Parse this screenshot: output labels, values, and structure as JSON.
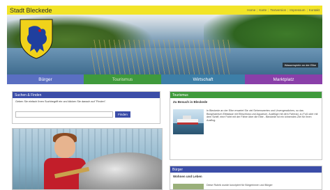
{
  "header": {
    "site_title": "Stadt Bleckede",
    "links": [
      "Home",
      "Karte",
      "Textversion",
      "Impressum",
      "Kontakt"
    ]
  },
  "hero": {
    "caption": "Wasserspiele an der Elbe"
  },
  "nav": {
    "items": [
      "Bürger",
      "Tourismus",
      "Wirtschaft",
      "Marktplatz"
    ]
  },
  "search": {
    "heading": "Suchen & Finden",
    "text": "Geben Sie einfach Ihren Suchbegriff ein und klicken Sie danach auf \"Finden\".",
    "placeholder": "",
    "button": "Finden"
  },
  "tourism": {
    "heading": "Tourismus",
    "subheading": "Zu Besuch in Bleckede",
    "text": "In Bleckede an der Elbe erwartet Sie viel Sehenswertes und Unvergessliches, so das Biosphaerium Elbtalaue mit Elbschloss und Aquarium. Ausflüge mit dem Fahrrad, zu Fuß oder mit dem Schiff, eine Fahrt mit der Fähre über die Elbe - Bleckede ist ein lohnendes Ziel für Ihren Ausflug."
  },
  "buerger": {
    "heading": "Bürger",
    "subheading": "Wohnen und Leben",
    "text": "Diese Rubrik wurde konzipiert für Bürgerinnen und Bürger"
  },
  "colors": {
    "topbar": "#f2e428",
    "nav_buerger": "#5a6fc2",
    "nav_tourismus": "#3f9a3c",
    "nav_wirtschaft": "#3d7fa8",
    "nav_marktplatz": "#8a3fa9"
  }
}
